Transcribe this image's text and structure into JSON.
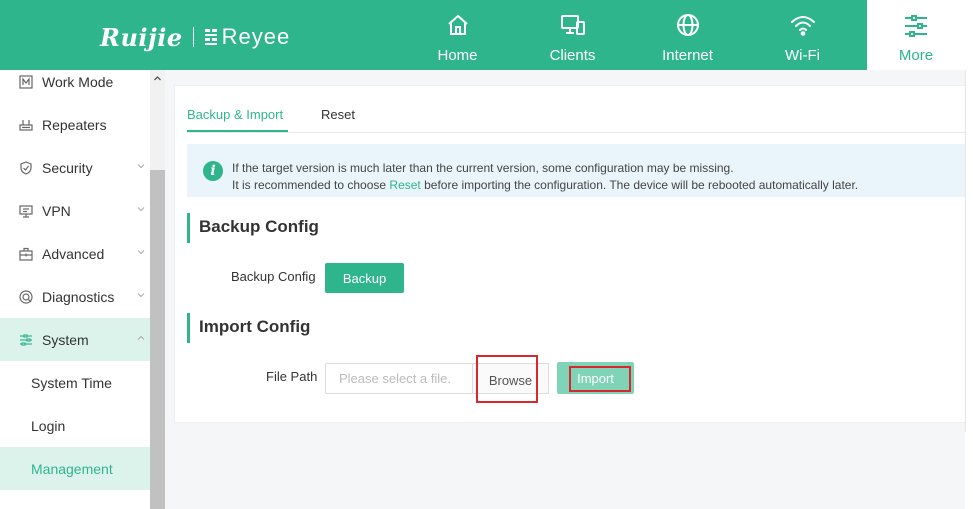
{
  "brand": {
    "primary": "Ruijie",
    "secondary": "Reyee"
  },
  "nav": [
    {
      "label": "Home",
      "icon": "home-icon"
    },
    {
      "label": "Clients",
      "icon": "devices-icon"
    },
    {
      "label": "Internet",
      "icon": "globe-icon"
    },
    {
      "label": "Wi-Fi",
      "icon": "wifi-icon"
    },
    {
      "label": "More",
      "icon": "sliders-icon",
      "active": true
    }
  ],
  "sidebar": {
    "items": [
      {
        "label": "Work Mode",
        "icon": "work-mode-icon"
      },
      {
        "label": "Repeaters",
        "icon": "repeaters-icon"
      },
      {
        "label": "Security",
        "icon": "shield-icon"
      },
      {
        "label": "VPN",
        "icon": "vpn-icon"
      },
      {
        "label": "Advanced",
        "icon": "toolbox-icon"
      },
      {
        "label": "Diagnostics",
        "icon": "diagnostics-icon"
      },
      {
        "label": "System",
        "icon": "sliders-icon",
        "active": true
      }
    ],
    "subitems": [
      {
        "label": "System Time"
      },
      {
        "label": "Login"
      },
      {
        "label": "Management",
        "active": true
      }
    ]
  },
  "tabs": [
    {
      "label": "Backup & Import",
      "active": true
    },
    {
      "label": "Reset"
    }
  ],
  "notice": {
    "line1": "If the target version is much later than the current version, some configuration may be missing.",
    "line2_prefix": "It is recommended to choose ",
    "line2_link": "Reset",
    "line2_suffix": " before importing the configuration. The device will be rebooted automatically later."
  },
  "backup": {
    "section_title": "Backup Config",
    "field_label": "Backup Config",
    "button_label": "Backup"
  },
  "import": {
    "section_title": "Import Config",
    "field_label": "File Path",
    "file_placeholder": "Please select a file.",
    "file_value": "",
    "browse_label": "Browse",
    "import_label": "Import"
  },
  "colors": {
    "brand": "#2fb58c",
    "active_bg": "#dcf3ec",
    "notice_bg": "#e9f4fb",
    "import_disabled": "#7fd4b8",
    "highlight": "#d9272e"
  }
}
